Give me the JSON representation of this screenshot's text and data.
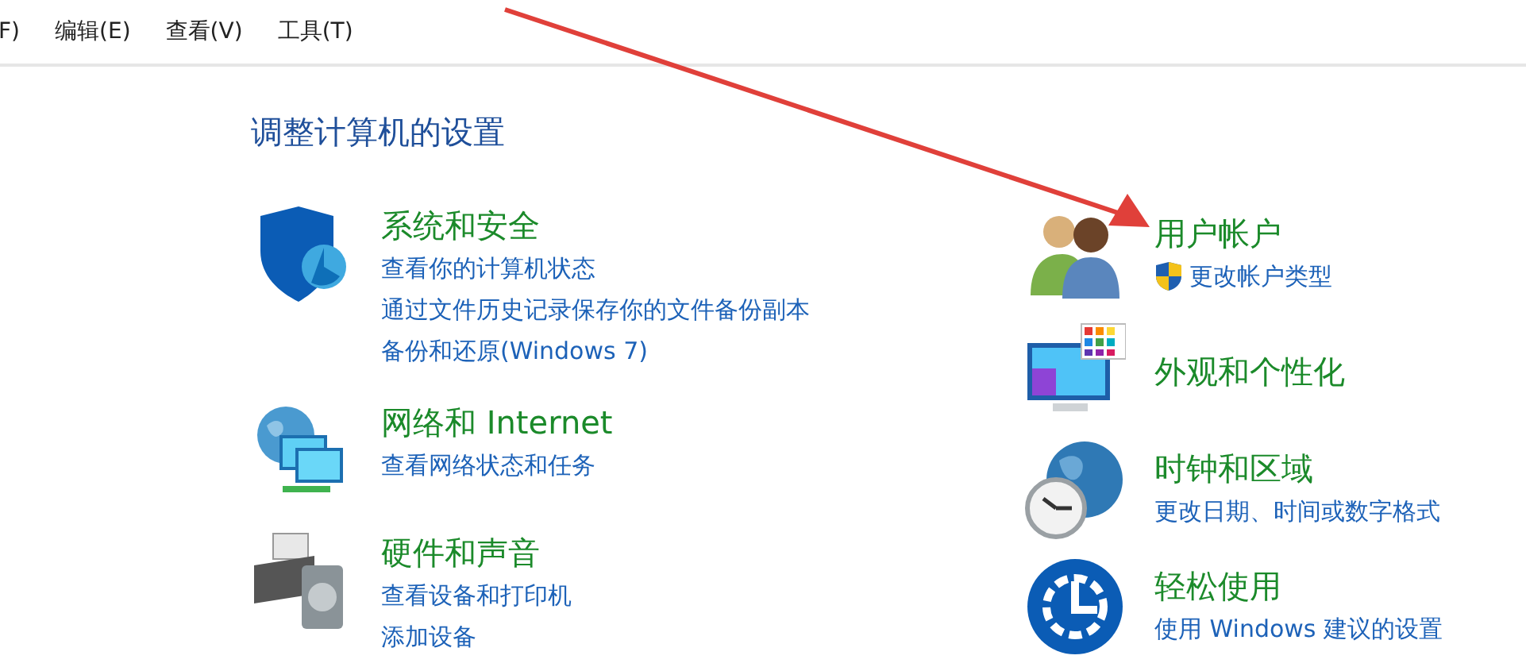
{
  "menu": [
    {
      "label": "F)"
    },
    {
      "label": "编辑(E)"
    },
    {
      "label": "查看(V)"
    },
    {
      "label": "工具(T)"
    }
  ],
  "heading": "调整计算机的设置",
  "left_column": [
    {
      "kind": "security",
      "title": "系统和安全",
      "links": [
        {
          "text": "查看你的计算机状态",
          "shield": false
        },
        {
          "text": "通过文件历史记录保存你的文件备份副本",
          "shield": false
        },
        {
          "text": "备份和还原(Windows 7)",
          "shield": false
        }
      ]
    },
    {
      "kind": "network",
      "title": "网络和 Internet",
      "links": [
        {
          "text": "查看网络状态和任务",
          "shield": false
        }
      ]
    },
    {
      "kind": "hardware",
      "title": "硬件和声音",
      "links": [
        {
          "text": "查看设备和打印机",
          "shield": false
        },
        {
          "text": "添加设备",
          "shield": false
        }
      ]
    }
  ],
  "right_column": [
    {
      "kind": "users",
      "title": "用户帐户",
      "links": [
        {
          "text": "更改帐户类型",
          "shield": true
        }
      ]
    },
    {
      "kind": "appearance",
      "title": "外观和个性化"
    },
    {
      "kind": "clock",
      "title": "时钟和区域",
      "links": [
        {
          "text": "更改日期、时间或数字格式",
          "shield": false
        }
      ]
    },
    {
      "kind": "access",
      "title": "轻松使用",
      "links": [
        {
          "text": "使用 Windows 建议的设置",
          "shield": false
        }
      ]
    }
  ]
}
